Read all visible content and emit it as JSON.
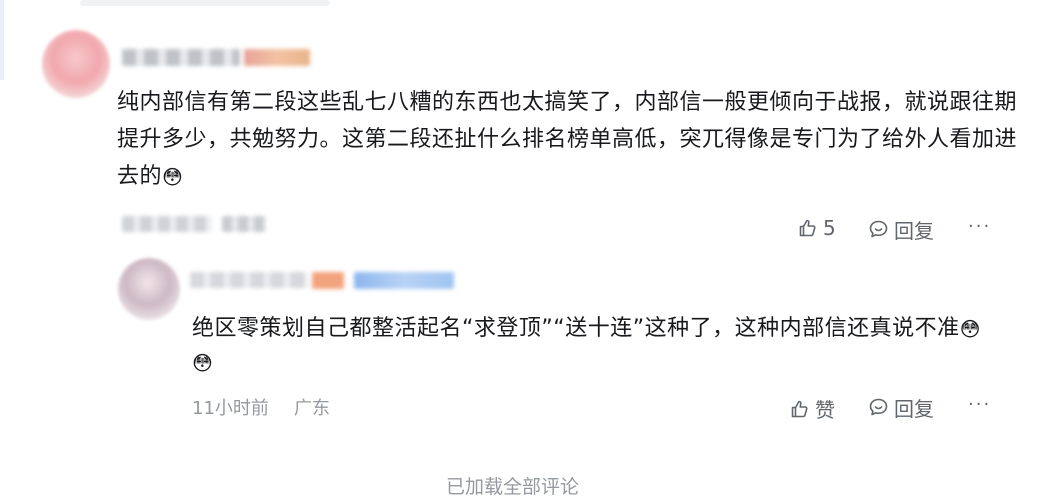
{
  "comment": {
    "text": "纯内部信有第二段这些乱七八糟的东西也太搞笑了，内部信一般更倾向于战报，就说跟往期提升多少，共勉努力。这第二段还扯什么排名榜单高低，突兀得像是专门为了给外人看加进去的",
    "emoji": "😳",
    "like_count": "5",
    "reply_label": "回复",
    "more_label": "···",
    "icons": {
      "like": "thumbs-up-icon",
      "reply": "chat-bubble-icon"
    }
  },
  "reply": {
    "text": "绝区零策划自己都整活起名“求登顶”“送十连”这种了，这种内部信还真说不准",
    "emoji": "😳",
    "emoji_second": "😳",
    "time": "11小时前",
    "location": "广东",
    "like_label": "赞",
    "reply_label": "回复",
    "more_label": "···"
  },
  "footer": {
    "text": "已加载全部评论"
  },
  "colors": {
    "text_primary": "#18191c",
    "text_secondary": "#9499a0",
    "action": "#61666d",
    "badge_orange": "#f3a37d",
    "badge_blue": "#9fc4f2"
  }
}
